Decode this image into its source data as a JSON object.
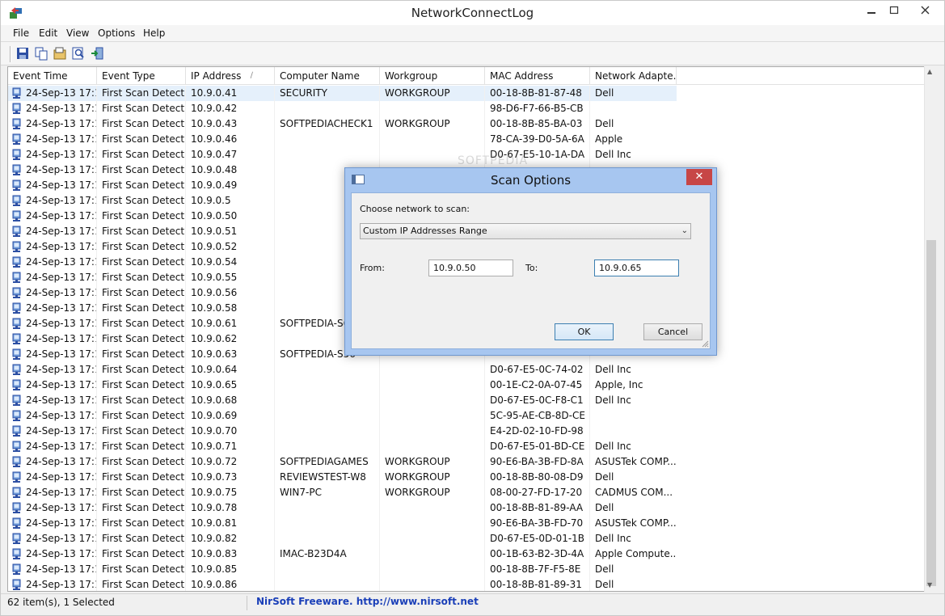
{
  "window": {
    "title": "NetworkConnectLog"
  },
  "menu": [
    "File",
    "Edit",
    "View",
    "Options",
    "Help"
  ],
  "toolbar": [
    {
      "name": "save-icon"
    },
    {
      "name": "copy-icon"
    },
    {
      "name": "properties-icon"
    },
    {
      "name": "find-icon"
    },
    {
      "name": "exit-icon"
    }
  ],
  "columns": [
    "Event Time",
    "Event Type",
    "IP Address",
    "Computer Name",
    "Workgroup",
    "MAC Address",
    "Network Adapte..."
  ],
  "rows": [
    [
      "24-Sep-13 17:1...",
      "First Scan Detect...",
      "10.9.0.41",
      "SECURITY",
      "WORKGROUP",
      "00-18-8B-81-87-48",
      "Dell"
    ],
    [
      "24-Sep-13 17:1...",
      "First Scan Detect...",
      "10.9.0.42",
      "",
      "",
      "98-D6-F7-66-B5-CB",
      ""
    ],
    [
      "24-Sep-13 17:1...",
      "First Scan Detect...",
      "10.9.0.43",
      "SOFTPEDIACHECK1",
      "WORKGROUP",
      "00-18-8B-85-BA-03",
      "Dell"
    ],
    [
      "24-Sep-13 17:1...",
      "First Scan Detect...",
      "10.9.0.46",
      "",
      "",
      "78-CA-39-D0-5A-6A",
      "Apple"
    ],
    [
      "24-Sep-13 17:1...",
      "First Scan Detect...",
      "10.9.0.47",
      "",
      "",
      "D0-67-E5-10-1A-DA",
      "Dell Inc"
    ],
    [
      "24-Sep-13 17:1...",
      "First Scan Detect...",
      "10.9.0.48",
      "",
      "",
      "",
      ""
    ],
    [
      "24-Sep-13 17:1...",
      "First Scan Detect...",
      "10.9.0.49",
      "",
      "",
      "",
      ""
    ],
    [
      "24-Sep-13 17:1...",
      "First Scan Detect...",
      "10.9.0.5",
      "",
      "",
      "",
      ""
    ],
    [
      "24-Sep-13 17:1...",
      "First Scan Detect...",
      "10.9.0.50",
      "",
      "",
      "",
      ""
    ],
    [
      "24-Sep-13 17:1...",
      "First Scan Detect...",
      "10.9.0.51",
      "",
      "",
      "",
      ""
    ],
    [
      "24-Sep-13 17:1...",
      "First Scan Detect...",
      "10.9.0.52",
      "",
      "",
      "",
      ""
    ],
    [
      "24-Sep-13 17:1...",
      "First Scan Detect...",
      "10.9.0.54",
      "",
      "",
      "",
      ""
    ],
    [
      "24-Sep-13 17:1...",
      "First Scan Detect...",
      "10.9.0.55",
      "",
      "",
      "",
      ""
    ],
    [
      "24-Sep-13 17:1...",
      "First Scan Detect...",
      "10.9.0.56",
      "",
      "",
      "",
      ""
    ],
    [
      "24-Sep-13 17:1...",
      "First Scan Detect...",
      "10.9.0.58",
      "",
      "",
      "",
      ""
    ],
    [
      "24-Sep-13 17:1...",
      "First Scan Detect...",
      "10.9.0.61",
      "SOFTPEDIA-S61",
      "",
      "",
      ""
    ],
    [
      "24-Sep-13 17:1...",
      "First Scan Detect...",
      "10.9.0.62",
      "",
      "",
      "",
      ""
    ],
    [
      "24-Sep-13 17:1...",
      "First Scan Detect...",
      "10.9.0.63",
      "SOFTPEDIA-S56",
      "",
      "",
      ""
    ],
    [
      "24-Sep-13 17:1...",
      "First Scan Detect...",
      "10.9.0.64",
      "",
      "",
      "D0-67-E5-0C-74-02",
      "Dell Inc"
    ],
    [
      "24-Sep-13 17:1...",
      "First Scan Detect...",
      "10.9.0.65",
      "",
      "",
      "00-1E-C2-0A-07-45",
      "Apple, Inc"
    ],
    [
      "24-Sep-13 17:1...",
      "First Scan Detect...",
      "10.9.0.68",
      "",
      "",
      "D0-67-E5-0C-F8-C1",
      "Dell Inc"
    ],
    [
      "24-Sep-13 17:1...",
      "First Scan Detect...",
      "10.9.0.69",
      "",
      "",
      "5C-95-AE-CB-8D-CE",
      ""
    ],
    [
      "24-Sep-13 17:1...",
      "First Scan Detect...",
      "10.9.0.70",
      "",
      "",
      "E4-2D-02-10-FD-98",
      ""
    ],
    [
      "24-Sep-13 17:1...",
      "First Scan Detect...",
      "10.9.0.71",
      "",
      "",
      "D0-67-E5-01-BD-CE",
      "Dell Inc"
    ],
    [
      "24-Sep-13 17:1...",
      "First Scan Detect...",
      "10.9.0.72",
      "SOFTPEDIAGAMES",
      "WORKGROUP",
      "90-E6-BA-3B-FD-8A",
      "ASUSTek COMP..."
    ],
    [
      "24-Sep-13 17:1...",
      "First Scan Detect...",
      "10.9.0.73",
      "REVIEWSTEST-W8",
      "WORKGROUP",
      "00-18-8B-80-08-D9",
      "Dell"
    ],
    [
      "24-Sep-13 17:1...",
      "First Scan Detect...",
      "10.9.0.75",
      "WIN7-PC",
      "WORKGROUP",
      "08-00-27-FD-17-20",
      "CADMUS COM..."
    ],
    [
      "24-Sep-13 17:1...",
      "First Scan Detect...",
      "10.9.0.78",
      "",
      "",
      "00-18-8B-81-89-AA",
      "Dell"
    ],
    [
      "24-Sep-13 17:1...",
      "First Scan Detect...",
      "10.9.0.81",
      "",
      "",
      "90-E6-BA-3B-FD-70",
      "ASUSTek COMP..."
    ],
    [
      "24-Sep-13 17:1...",
      "First Scan Detect...",
      "10.9.0.82",
      "",
      "",
      "D0-67-E5-0D-01-1B",
      "Dell Inc"
    ],
    [
      "24-Sep-13 17:1...",
      "First Scan Detect...",
      "10.9.0.83",
      "IMAC-B23D4A",
      "",
      "00-1B-63-B2-3D-4A",
      "Apple Compute..."
    ],
    [
      "24-Sep-13 17:1...",
      "First Scan Detect...",
      "10.9.0.85",
      "",
      "",
      "00-18-8B-7F-F5-8E",
      "Dell"
    ],
    [
      "24-Sep-13 17:1...",
      "First Scan Detect...",
      "10.9.0.86",
      "",
      "",
      "00-18-8B-81-89-31",
      "Dell"
    ]
  ],
  "selected_row": 0,
  "status": {
    "items": "62 item(s), 1 Selected",
    "nirsoft": "NirSoft Freeware.  http://www.nirsoft.net"
  },
  "dialog": {
    "title": "Scan Options",
    "choose_label": "Choose network to scan:",
    "network_selected": "Custom IP Addresses Range",
    "from_label": "From:",
    "from_value": "10.9.0.50",
    "to_label": "To:",
    "to_value": "10.9.0.65",
    "ok": "OK",
    "cancel": "Cancel"
  },
  "colors": {
    "dialog_frame": "#a7c6f0",
    "close_button": "#c74646",
    "selection": "#e5f0fb",
    "status_link": "#1a3fb8"
  }
}
